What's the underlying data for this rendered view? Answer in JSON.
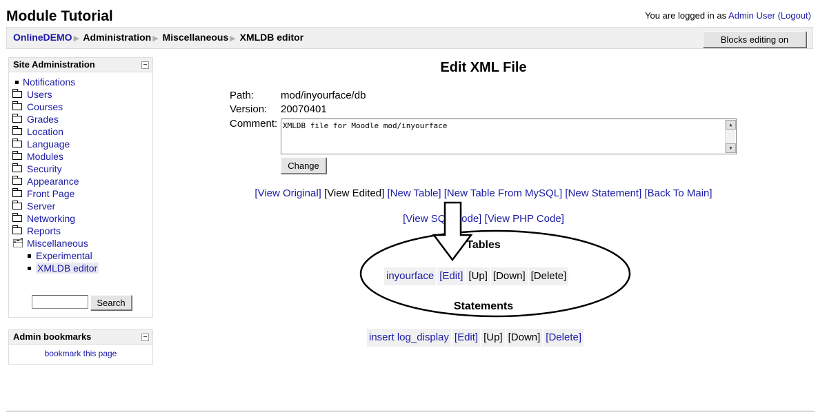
{
  "header": {
    "site_title": "Module Tutorial",
    "login_prefix": "You are logged in as ",
    "user_name": "Admin User",
    "logout_label": "(Logout)"
  },
  "navbar": {
    "breadcrumbs": [
      "OnlineDEMO",
      "Administration",
      "Miscellaneous",
      "XMLDB editor"
    ],
    "blocks_editing_button": "Blocks editing on"
  },
  "site_admin": {
    "title": "Site Administration",
    "items": [
      {
        "label": "Notifications",
        "icon": "bullet"
      },
      {
        "label": "Users",
        "icon": "folder"
      },
      {
        "label": "Courses",
        "icon": "folder"
      },
      {
        "label": "Grades",
        "icon": "folder"
      },
      {
        "label": "Location",
        "icon": "folder"
      },
      {
        "label": "Language",
        "icon": "folder"
      },
      {
        "label": "Modules",
        "icon": "folder"
      },
      {
        "label": "Security",
        "icon": "folder"
      },
      {
        "label": "Appearance",
        "icon": "folder"
      },
      {
        "label": "Front Page",
        "icon": "folder"
      },
      {
        "label": "Server",
        "icon": "folder"
      },
      {
        "label": "Networking",
        "icon": "folder"
      },
      {
        "label": "Reports",
        "icon": "folder"
      },
      {
        "label": "Miscellaneous",
        "icon": "folder-open"
      },
      {
        "label": "Experimental",
        "icon": "bullet"
      },
      {
        "label": "XMLDB editor",
        "icon": "bullet"
      }
    ],
    "search_value": "",
    "search_button": "Search"
  },
  "admin_bookmarks": {
    "title": "Admin bookmarks",
    "link": "bookmark this page"
  },
  "main": {
    "heading": "Edit XML File",
    "path_label": "Path:",
    "path_value": "mod/inyourface/db",
    "version_label": "Version:",
    "version_value": "20070401",
    "comment_label": "Comment:",
    "comment_value": "XMLDB file for Moodle mod/inyourface",
    "change_button": "Change",
    "actions_row1": [
      "[View Original]",
      "[View Edited]",
      "[New Table]",
      "[New Table From MySQL]",
      "[New Statement]",
      "[Back To Main]"
    ],
    "actions_row2": [
      "[View SQL Code]",
      "[View PHP Code]"
    ],
    "tables_title": "Tables",
    "table_row": {
      "name": "inyourface",
      "edit": "[Edit]",
      "up": "[Up]",
      "down": "[Down]",
      "delete": "[Delete]"
    },
    "statements_title": "Statements",
    "statement_row": {
      "name": "insert log_display",
      "edit": "[Edit]",
      "up": "[Up]",
      "down": "[Down]",
      "delete": "[Delete]"
    }
  },
  "colors": {
    "link": "#1a1aa6",
    "navbar_bg": "#f0f0f0",
    "row_bg": "#f0f0f0"
  }
}
